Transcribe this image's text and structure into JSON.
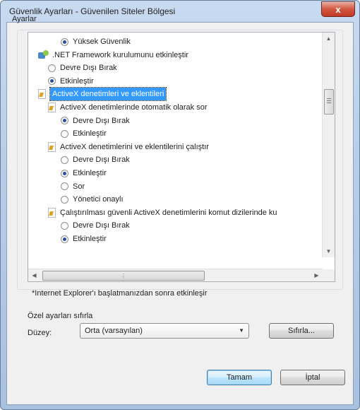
{
  "window": {
    "title": "Güvenlik Ayarları - Güvenilen Siteler Bölgesi",
    "close_label": "x"
  },
  "settings": {
    "group_label": "Ayarlar",
    "items": [
      {
        "type": "radio",
        "label": "Yüksek Güvenlik",
        "checked": true,
        "indent": 2
      },
      {
        "type": "header",
        "icon": "dotnet-icon",
        "label": ".NET Framework kurulumunu etkinleştir",
        "indent": 0
      },
      {
        "type": "radio",
        "label": "Devre Dışı Bırak",
        "checked": false,
        "indent": 1
      },
      {
        "type": "radio",
        "label": "Etkinleştir",
        "checked": true,
        "indent": 1
      },
      {
        "type": "header",
        "icon": "activex-icon",
        "label": "ActiveX denetimleri ve eklentileri",
        "selected": true,
        "indent": 0
      },
      {
        "type": "header",
        "icon": "activex-icon",
        "label": "ActiveX denetimlerinde otomatik olarak sor",
        "indent": 1
      },
      {
        "type": "radio",
        "label": "Devre Dışı Bırak",
        "checked": true,
        "indent": 2
      },
      {
        "type": "radio",
        "label": "Etkinleştir",
        "checked": false,
        "indent": 2
      },
      {
        "type": "header",
        "icon": "activex-icon",
        "label": "ActiveX denetimlerini ve eklentilerini çalıştır",
        "indent": 1
      },
      {
        "type": "radio",
        "label": "Devre Dışı Bırak",
        "checked": false,
        "indent": 2
      },
      {
        "type": "radio",
        "label": "Etkinleştir",
        "checked": true,
        "indent": 2
      },
      {
        "type": "radio",
        "label": "Sor",
        "checked": false,
        "indent": 2
      },
      {
        "type": "radio",
        "label": "Yönetici onaylı",
        "checked": false,
        "indent": 2
      },
      {
        "type": "header",
        "icon": "activex-icon",
        "label": "Çalıştırılması güvenli ActiveX denetimlerini komut dizilerinde ku",
        "indent": 1
      },
      {
        "type": "radio",
        "label": "Devre Dışı Bırak",
        "checked": false,
        "indent": 2
      },
      {
        "type": "radio",
        "label": "Etkinleştir",
        "checked": true,
        "indent": 2
      }
    ]
  },
  "note": "*Internet Explorer'ı başlatmanızdan sonra etkinleşir",
  "reset": {
    "title": "Özel ayarları sıfırla",
    "level_label": "Düzey:",
    "level_value": "Orta (varsayılan)",
    "reset_button": "Sıfırla..."
  },
  "buttons": {
    "ok": "Tamam",
    "cancel": "İptal"
  }
}
